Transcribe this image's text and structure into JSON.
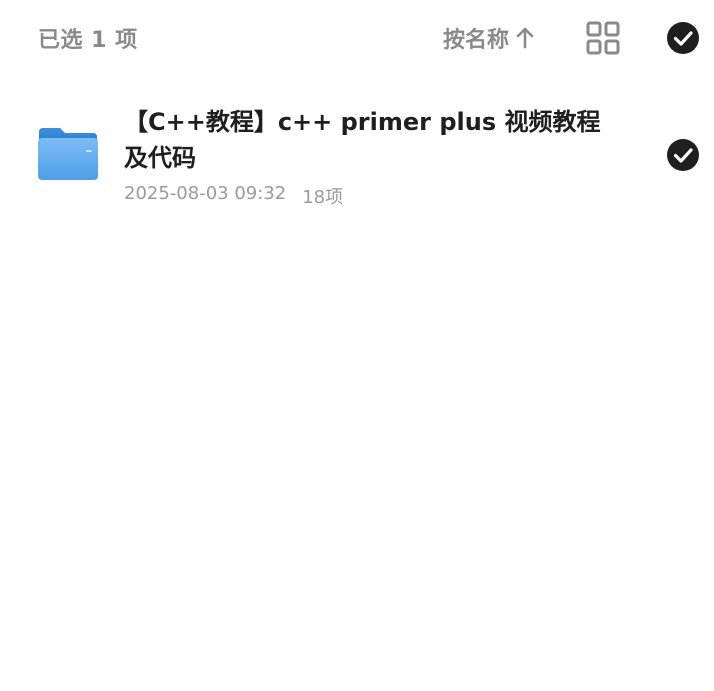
{
  "header": {
    "selected_count_label": "已选 1 项",
    "sort_label": "按名称",
    "sort_direction_icon": "arrow-up-icon",
    "view_toggle_icon": "grid-view-icon",
    "select_all_icon": "check-circle-icon"
  },
  "files": [
    {
      "name": "【C++教程】c++ primer plus 视频教程及代码",
      "date": "2025-08-03 09:32",
      "item_count": "18项",
      "icon": "folder-icon",
      "selected": true
    }
  ],
  "colors": {
    "header_text": "#8a8a8a",
    "meta_text": "#9a9a9a",
    "title_text": "#1f1f1f",
    "check_fill": "#1f1f1f",
    "folder_blue": "#5aa7f0"
  }
}
